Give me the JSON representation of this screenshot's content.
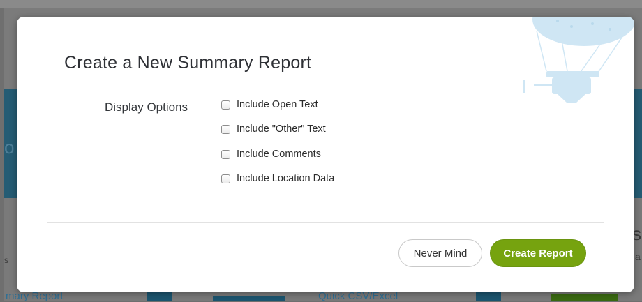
{
  "modal": {
    "title": "Create a New Summary Report",
    "display_options_label": "Display Options",
    "options": [
      {
        "label": "Include Open Text",
        "checked": false
      },
      {
        "label": "Include \"Other\" Text",
        "checked": false
      },
      {
        "label": "Include Comments",
        "checked": false
      },
      {
        "label": "Include Location Data",
        "checked": false
      }
    ],
    "cancel_label": "Never Mind",
    "submit_label": "Create Report"
  },
  "background": {
    "link_left": "mary Report",
    "link_middle": "Quick CSV/Excel",
    "fragment_right_large": "s",
    "fragment_right_small": "a",
    "fragment_left_large": "o",
    "fragment_left_small": "s"
  },
  "colors": {
    "primary_button": "#76a30f",
    "title_text": "#2f3136",
    "overlay": "#6f6f6f",
    "balloon": "#cfe6f4"
  },
  "icons": [
    "hot-air-balloon-illustration",
    "checkbox"
  ]
}
